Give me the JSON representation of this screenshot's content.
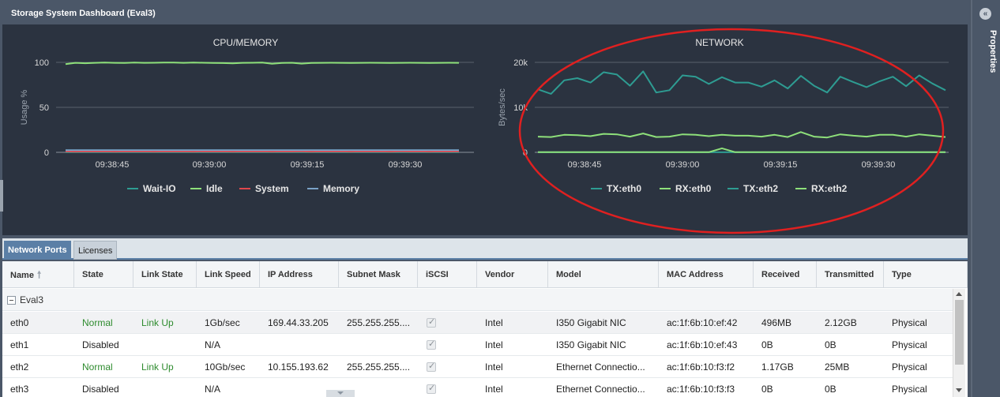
{
  "window": {
    "title": "Storage System Dashboard (Eval3)"
  },
  "right_panel": {
    "label": "Properties"
  },
  "chart_data": [
    {
      "type": "line",
      "title": "CPU/MEMORY",
      "ylabel": "Usage %",
      "xlabel": "",
      "ylim": [
        0,
        100
      ],
      "yticks": [
        "100",
        "50",
        "0"
      ],
      "xticks": [
        "09:38:45",
        "09:39:00",
        "09:39:15",
        "09:39:30"
      ],
      "grid": true,
      "legend_position": "bottom",
      "series": [
        {
          "name": "Wait-IO",
          "color": "#2e9c92",
          "values": [
            0.1,
            0.1,
            0.1,
            0.1,
            0.1,
            0.1,
            0.1,
            0.1,
            0.1,
            0.1,
            0.1,
            0.1,
            0.1,
            0.1,
            0.1,
            0.1,
            0.1,
            0.1,
            0.1,
            0.1,
            0.1,
            0.1,
            0.1,
            0.1,
            0.1,
            0.1,
            0.1,
            0.1,
            0.1,
            0.1,
            0.1,
            0.1,
            0.1,
            0.1,
            0.1,
            0.1,
            0.1,
            0.1,
            0.1,
            0.1,
            0.1
          ]
        },
        {
          "name": "Idle",
          "color": "#8ee07a",
          "values": [
            98,
            99.5,
            99,
            99.5,
            99.8,
            99.5,
            99.3,
            99.7,
            99.5,
            99.6,
            99.8,
            99.7,
            99.5,
            99.8,
            99.6,
            99.4,
            99.2,
            98.9,
            99.5,
            99.6,
            99.7,
            98.5,
            99.4,
            99.6,
            98.6,
            99.4,
            99.5,
            99.6,
            99.5,
            99.4,
            99.5,
            99.6,
            99.5,
            99.4,
            99.5,
            99.6,
            99.5,
            99.4,
            99.5,
            99.6,
            99.5
          ]
        },
        {
          "name": "System",
          "color": "#e0474c",
          "values": [
            1,
            0.8,
            1,
            0.9,
            1,
            0.8,
            1,
            0.9,
            1,
            0.8,
            1,
            0.9,
            1,
            0.8,
            1,
            0.9,
            1,
            0.8,
            1,
            0.9,
            1,
            0.8,
            1,
            0.9,
            1,
            0.8,
            1,
            0.9,
            1,
            0.8,
            1,
            0.9,
            1,
            0.8,
            1,
            0.9,
            1,
            0.8,
            1,
            0.9,
            1
          ]
        },
        {
          "name": "Memory",
          "color": "#7aa3c8",
          "values": [
            2.5,
            2.5,
            2.5,
            2.5,
            2.5,
            2.5,
            2.5,
            2.5,
            2.5,
            2.5,
            2.5,
            2.5,
            2.5,
            2.5,
            2.5,
            2.5,
            2.5,
            2.5,
            2.5,
            2.5,
            2.5,
            2.5,
            2.5,
            2.5,
            2.5,
            2.5,
            2.5,
            2.5,
            2.5,
            2.5,
            2.5,
            2.5,
            2.5,
            2.5,
            2.5,
            2.5,
            2.5,
            2.5,
            2.5,
            2.5,
            2.5,
            2.5,
            2.5,
            2.5,
            2.5,
            2.5,
            2.5,
            2.5,
            2.5,
            2.5
          ]
        }
      ]
    },
    {
      "type": "line",
      "title": "NETWORK",
      "ylabel": "Bytes/sec",
      "xlabel": "",
      "ylim": [
        0,
        20000
      ],
      "yticks": [
        "20k",
        "10k",
        "0"
      ],
      "xticks": [
        "09:38:45",
        "09:39:00",
        "09:39:15",
        "09:39:30"
      ],
      "grid": true,
      "legend_position": "bottom",
      "highlight": "red ellipse around chart",
      "series": [
        {
          "name": "TX:eth0",
          "color": "#2e9c92",
          "values": [
            14000,
            13000,
            16000,
            16500,
            15500,
            17800,
            17300,
            14800,
            18000,
            13300,
            13800,
            17100,
            16800,
            15200,
            16700,
            15500,
            15500,
            14600,
            16000,
            14200,
            17000,
            14800,
            13300,
            16800,
            15600,
            14500,
            15800,
            16800,
            14700,
            17100,
            15300,
            13800
          ]
        },
        {
          "name": "RX:eth0",
          "color": "#8ee07a",
          "values": [
            3500,
            3400,
            3900,
            3800,
            3600,
            4100,
            4000,
            3500,
            4200,
            3400,
            3500,
            4000,
            3900,
            3600,
            3900,
            3700,
            3700,
            3500,
            3900,
            3400,
            4500,
            3500,
            3300,
            4000,
            3700,
            3500,
            3900,
            3900,
            3500,
            4000,
            3700,
            3400
          ]
        },
        {
          "name": "TX:eth2",
          "color": "#2e9c92",
          "values": [
            20,
            20,
            20,
            20,
            20,
            20,
            20,
            20,
            20,
            20,
            20,
            20,
            20,
            20,
            20,
            20,
            20,
            20,
            20,
            20,
            20,
            20,
            20,
            20,
            20,
            20,
            20,
            20,
            20,
            20,
            20,
            20
          ]
        },
        {
          "name": "RX:eth2",
          "color": "#8ee07a",
          "values": [
            30,
            30,
            30,
            30,
            30,
            30,
            30,
            30,
            30,
            30,
            30,
            30,
            30,
            30,
            900,
            30,
            30,
            30,
            30,
            30,
            30,
            30,
            30,
            30,
            30,
            30,
            30,
            30,
            30,
            30,
            30,
            30
          ]
        }
      ]
    }
  ],
  "tabs": [
    {
      "label": "Network Ports",
      "active": true
    },
    {
      "label": "Licenses",
      "active": false
    }
  ],
  "table": {
    "columns": [
      "Name",
      "State",
      "Link State",
      "Link Speed",
      "IP Address",
      "Subnet Mask",
      "iSCSI",
      "Vendor",
      "Model",
      "MAC Address",
      "Received",
      "Transmitted",
      "Type"
    ],
    "sort_icon": "sort-up-arrow-icon",
    "group": "Eval3",
    "rows": [
      {
        "name": "eth0",
        "state": "Normal",
        "link_state": "Link Up",
        "link_speed": "1Gb/sec",
        "ip": "169.44.33.205",
        "subnet": "255.255.255....",
        "iscsi": true,
        "vendor": "Intel",
        "model": "I350 Gigabit NIC",
        "mac": "ac:1f:6b:10:ef:42",
        "received": "496MB",
        "transmitted": "2.12GB",
        "type": "Physical"
      },
      {
        "name": "eth1",
        "state": "Disabled",
        "link_state": "",
        "link_speed": "N/A",
        "ip": "",
        "subnet": "",
        "iscsi": true,
        "vendor": "Intel",
        "model": "I350 Gigabit NIC",
        "mac": "ac:1f:6b:10:ef:43",
        "received": "0B",
        "transmitted": "0B",
        "type": "Physical"
      },
      {
        "name": "eth2",
        "state": "Normal",
        "link_state": "Link Up",
        "link_speed": "10Gb/sec",
        "ip": "10.155.193.62",
        "subnet": "255.255.255....",
        "iscsi": true,
        "vendor": "Intel",
        "model": "Ethernet Connectio...",
        "mac": "ac:1f:6b:10:f3:f2",
        "received": "1.17GB",
        "transmitted": "25MB",
        "type": "Physical"
      },
      {
        "name": "eth3",
        "state": "Disabled",
        "link_state": "",
        "link_speed": "N/A",
        "ip": "",
        "subnet": "",
        "iscsi": true,
        "vendor": "Intel",
        "model": "Ethernet Connectio...",
        "mac": "ac:1f:6b:10:f3:f3",
        "received": "0B",
        "transmitted": "0B",
        "type": "Physical"
      }
    ]
  },
  "colors": {
    "accent": "#5b7fa6",
    "status_green": "#2e8b2e",
    "highlight_red": "#e02020"
  }
}
